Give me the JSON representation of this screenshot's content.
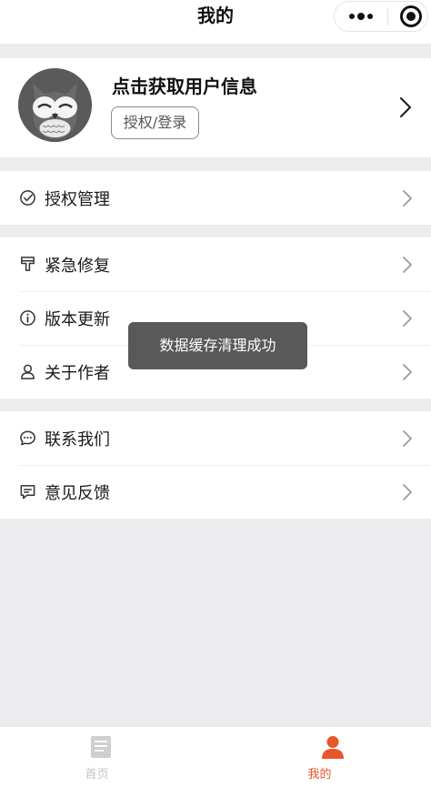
{
  "navbar": {
    "title": "我的"
  },
  "profile": {
    "name": "点击获取用户信息",
    "login_label": "授权/登录"
  },
  "menu": {
    "group1": [
      {
        "label": "授权管理",
        "icon": "check-circle-icon"
      }
    ],
    "group2": [
      {
        "label": "紧急修复",
        "icon": "brush-icon"
      },
      {
        "label": "版本更新",
        "icon": "info-icon"
      },
      {
        "label": "关于作者",
        "icon": "user-icon"
      }
    ],
    "group3": [
      {
        "label": "联系我们",
        "icon": "chat-bubble-icon"
      },
      {
        "label": "意见反馈",
        "icon": "feedback-icon"
      }
    ]
  },
  "toast": {
    "message": "数据缓存清理成功"
  },
  "tabbar": {
    "tabs": [
      {
        "label": "首页",
        "icon": "document-icon",
        "active": false
      },
      {
        "label": "我的",
        "icon": "person-icon",
        "active": true
      }
    ]
  },
  "colors": {
    "accent": "#e8562a",
    "inactive": "#c4c4c4",
    "page_bg": "#ededf0"
  }
}
